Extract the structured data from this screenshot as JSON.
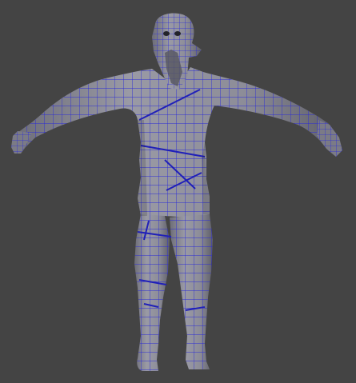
{
  "viewport": {
    "background": "#444444",
    "shading": "gray-shaded",
    "wireframe_overlay": true,
    "wire_color": "#2a2ad0"
  },
  "model": {
    "description_icon": "t-pose-character-mesh",
    "skin_color": "#8f8f99",
    "skin_shadow": "#66666f"
  }
}
